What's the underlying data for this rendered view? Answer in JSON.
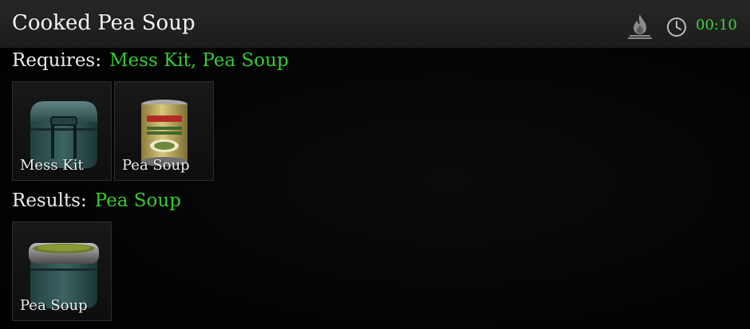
{
  "header": {
    "title": "Cooked Pea Soup",
    "time": "00:10",
    "time_color": "#3fd23f",
    "icons": [
      "fire-icon",
      "clock-icon"
    ]
  },
  "requires": {
    "label": "Requires:",
    "value": "Mess Kit, Pea Soup",
    "items": [
      {
        "label": "Mess Kit",
        "icon": "mess-kit-icon"
      },
      {
        "label": "Pea Soup",
        "icon": "pea-soup-can-icon"
      }
    ]
  },
  "results": {
    "label": "Results:",
    "value": "Pea Soup",
    "items": [
      {
        "label": "Pea Soup",
        "icon": "mess-kit-with-soup-icon"
      }
    ]
  },
  "colors": {
    "accent_green": "#33cc33",
    "header_bg": "#232323",
    "panel_bg": "#000000"
  }
}
